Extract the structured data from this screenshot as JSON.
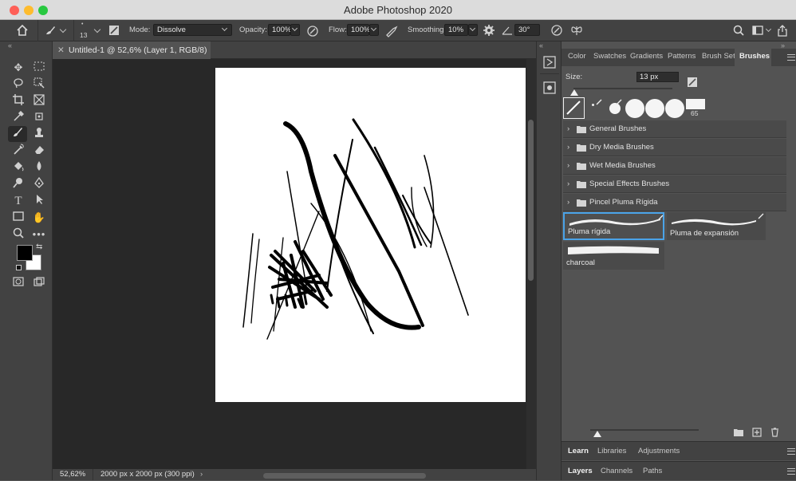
{
  "window": {
    "title": "Adobe Photoshop 2020"
  },
  "options_bar": {
    "brush_size": "13",
    "mode_label": "Mode:",
    "mode_value": "Dissolve",
    "opacity_label": "Opacity:",
    "opacity_value": "100%",
    "flow_label": "Flow:",
    "flow_value": "100%",
    "smoothing_label": "Smoothing:",
    "smoothing_value": "10%",
    "angle_value": "30°"
  },
  "document": {
    "tab_title": "Untitled-1 @ 52,6% (Layer 1, RGB/8) *",
    "zoom": "52,62%",
    "doc_info": "2000 px x 2000 px (300 ppi)"
  },
  "panel_tabs": [
    {
      "label": "Color"
    },
    {
      "label": "Swatches"
    },
    {
      "label": "Gradients"
    },
    {
      "label": "Patterns"
    },
    {
      "label": "Brush Sett"
    },
    {
      "label": "Brushes"
    }
  ],
  "brushes": {
    "size_label": "Size:",
    "size_value": "13 px",
    "preset_count": "65",
    "folders": [
      {
        "label": "General Brushes"
      },
      {
        "label": "Dry Media Brushes"
      },
      {
        "label": "Wet Media Brushes"
      },
      {
        "label": "Special Effects Brushes"
      },
      {
        "label": "Pincel Pluma Rígida"
      }
    ],
    "items": [
      {
        "label": "Pluma rígida"
      },
      {
        "label": "Pluma de expansión"
      },
      {
        "label": "charcoal"
      }
    ]
  },
  "learn_tabs": [
    {
      "label": "Learn"
    },
    {
      "label": "Libraries"
    },
    {
      "label": "Adjustments"
    }
  ],
  "layers_tabs": [
    {
      "label": "Layers"
    },
    {
      "label": "Channels"
    },
    {
      "label": "Paths"
    }
  ],
  "colors": {
    "accent": "#4aa3e8",
    "foreground": "#000000",
    "background": "#ffffff"
  }
}
